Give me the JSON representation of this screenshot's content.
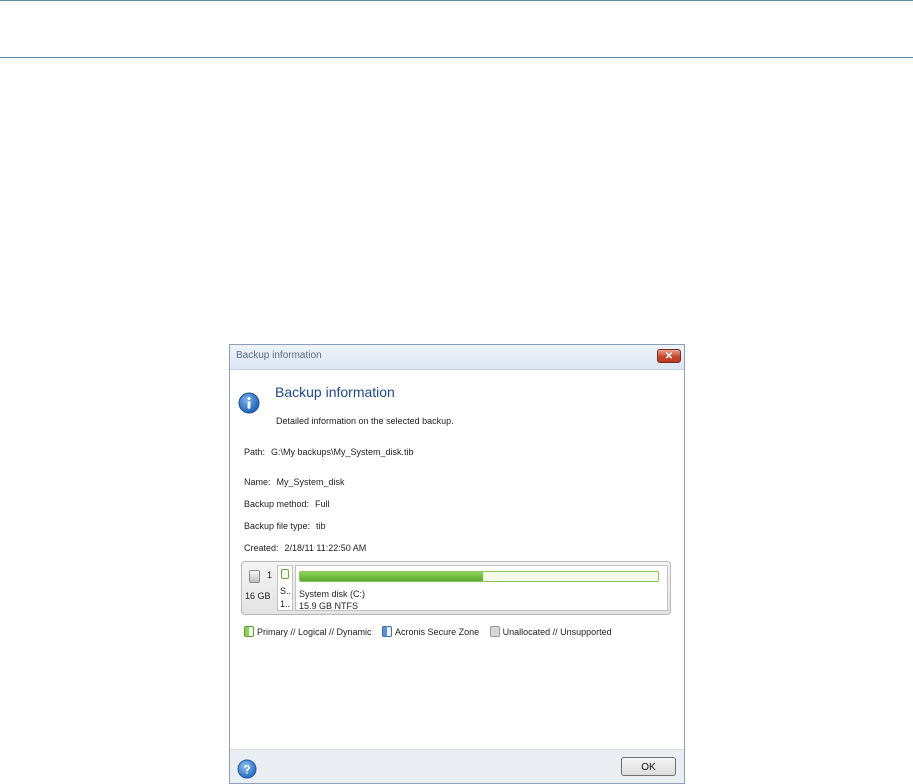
{
  "dialog": {
    "title": "Backup information",
    "heading": "Backup information",
    "subtitle": "Detailed information on the selected backup.",
    "close_icon": "close-icon",
    "info_icon": "info-icon"
  },
  "fields": {
    "path": {
      "label": "Path:",
      "value": "G:\\My backups\\My_System_disk.tib"
    },
    "name": {
      "label": "Name:",
      "value": "My_System_disk"
    },
    "method": {
      "label": "Backup method:",
      "value": "Full"
    },
    "file_type": {
      "label": "Backup file type:",
      "value": "tib"
    },
    "created": {
      "label": "Created:",
      "value": "2/18/11 11:22:50 AM"
    }
  },
  "disk": {
    "number": "1",
    "size": "16 GB",
    "partition_short_line1": "S..",
    "partition_short_line2": "1..",
    "partition_name": "System disk (C:)",
    "partition_detail": "15.9 GB  NTFS",
    "usage_fraction": 0.51,
    "fill_color": "#6db83c"
  },
  "legend": {
    "primary": "Primary // Logical // Dynamic",
    "secure_zone": "Acronis Secure Zone",
    "unallocated": "Unallocated // Unsupported"
  },
  "footer": {
    "ok_label": "OK",
    "help_icon": "help-icon"
  }
}
